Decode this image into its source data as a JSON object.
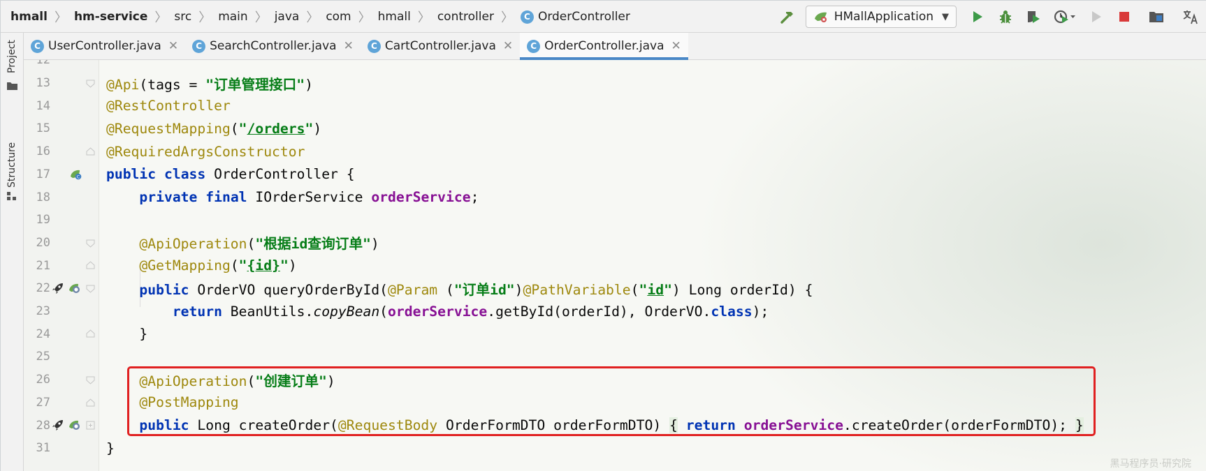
{
  "breadcrumb": [
    "hmall",
    "hm-service",
    "src",
    "main",
    "java",
    "com",
    "hmall",
    "controller",
    "OrderController"
  ],
  "toolbar": {
    "run_config": "HMallApplication",
    "icons": [
      "hammer-icon",
      "run-icon",
      "debug-icon",
      "coverage-icon",
      "profile-icon",
      "attach-icon",
      "stop-icon",
      "project-structure-icon",
      "translate-icon"
    ]
  },
  "side_panel": {
    "project_label": "Project",
    "structure_label": "Structure"
  },
  "tabs": [
    {
      "label": "UserController.java",
      "active": false
    },
    {
      "label": "SearchController.java",
      "active": false
    },
    {
      "label": "CartController.java",
      "active": false
    },
    {
      "label": "OrderController.java",
      "active": true
    }
  ],
  "editor": {
    "lines": [
      {
        "num": "12"
      },
      {
        "num": "13"
      },
      {
        "num": "14"
      },
      {
        "num": "15"
      },
      {
        "num": "16"
      },
      {
        "num": "17"
      },
      {
        "num": "18"
      },
      {
        "num": "19"
      },
      {
        "num": "20"
      },
      {
        "num": "21"
      },
      {
        "num": "22"
      },
      {
        "num": "23"
      },
      {
        "num": "24"
      },
      {
        "num": "25"
      },
      {
        "num": "26"
      },
      {
        "num": "27"
      },
      {
        "num": "28"
      },
      {
        "num": "31"
      }
    ],
    "tokens": {
      "l13_ann": "@Api",
      "l13_a": "(tags = ",
      "l13_str": "\"订单管理接口\"",
      "l13_b": ")",
      "l14_ann": "@RestController",
      "l15_ann": "@RequestMapping",
      "l15_a": "(",
      "l15_q1": "\"",
      "l15_path": "/orders",
      "l15_q2": "\"",
      "l15_b": ")",
      "l16_ann": "@RequiredArgsConstructor",
      "l17_kw1": "public",
      "l17_kw2": "class",
      "l17_rest": " OrderController {",
      "l18_kw1": "private",
      "l18_kw2": "final",
      "l18_type": " IOrderService ",
      "l18_field": "orderService",
      "l18_end": ";",
      "l20_ann": "@ApiOperation",
      "l20_a": "(",
      "l20_str": "\"根据id查询订单\"",
      "l20_b": ")",
      "l21_ann": "@GetMapping",
      "l21_a": "(",
      "l21_q1": "\"",
      "l21_path": "{id}",
      "l21_q2": "\"",
      "l21_b": ")",
      "l22_kw1": "public",
      "l22_a": " OrderVO queryOrderById(",
      "l22_ann1": "@Param",
      "l22_b": " (",
      "l22_str1": "\"订单id\"",
      "l22_c": ")",
      "l22_ann2": "@PathVariable",
      "l22_d": "(",
      "l22_q1": "\"",
      "l22_id": "id",
      "l22_q2": "\"",
      "l22_e": ") Long orderId) {",
      "l23_kw": "return",
      "l23_a": " BeanUtils.",
      "l23_m": "copyBean",
      "l23_b": "(",
      "l23_field": "orderService",
      "l23_c": ".getById(orderId), OrderVO.",
      "l23_kw2": "class",
      "l23_d": ");",
      "l24": "}",
      "l26_ann": "@ApiOperation",
      "l26_a": "(",
      "l26_str": "\"创建订单\"",
      "l26_b": ")",
      "l27_ann": "@PostMapping",
      "l28_kw": "public",
      "l28_a": " Long createOrder(",
      "l28_ann": "@RequestBody",
      "l28_b": " OrderFormDTO orderFormDTO) ",
      "l28_br1": "{",
      "l28_kw2": "return",
      "l28_field": "orderService",
      "l28_c": ".createOrder(orderFormDTO); ",
      "l28_br2": "}",
      "l31": "}"
    }
  },
  "watermark": "黑马程序员·研究院",
  "colors": {
    "keyword": "#0033b3",
    "annotation": "#9e880d",
    "string": "#067d17",
    "field": "#871094",
    "highlight_box": "#e02020",
    "tab_active_underline": "#4a88c7"
  }
}
